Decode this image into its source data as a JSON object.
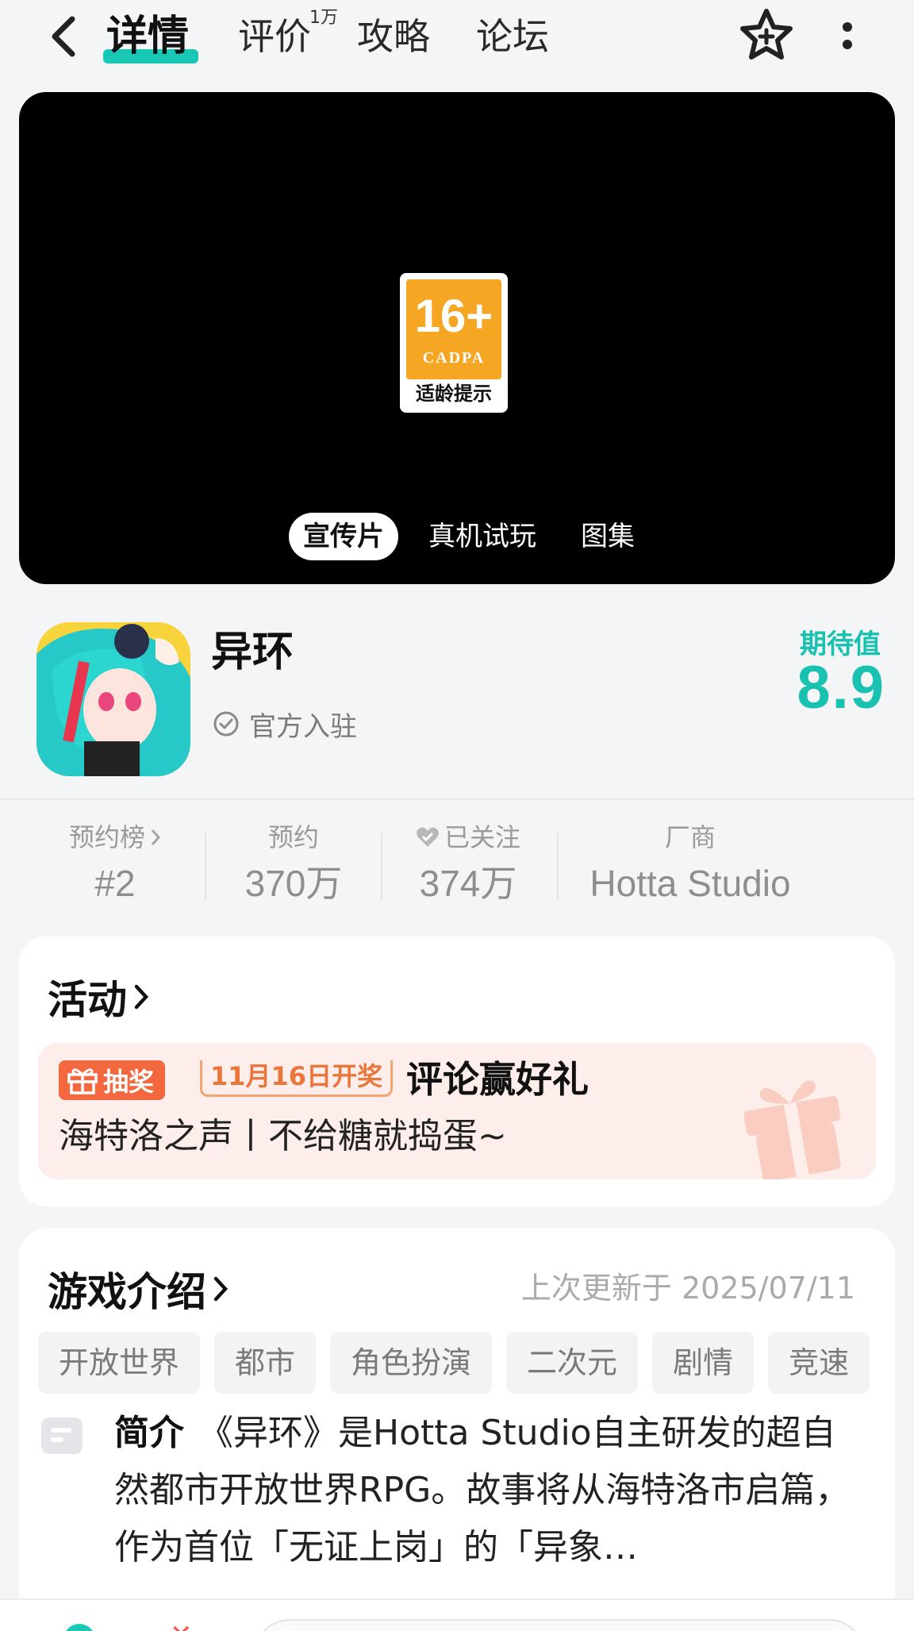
{
  "nav": {
    "tabs": [
      "详情",
      "评价",
      "攻略",
      "论坛"
    ],
    "review_badge": "1万"
  },
  "video": {
    "age_rating": "16+",
    "age_org": "CADPA",
    "age_caption": "适龄提示",
    "media_tabs": [
      "宣传片",
      "真机试玩",
      "图集"
    ],
    "active_media_tab": "宣传片"
  },
  "game": {
    "name": "异环",
    "official_label": "官方入驻",
    "expect_label": "期待值",
    "expect_score": "8.9"
  },
  "stats": [
    {
      "label": "预约榜",
      "value": "#2"
    },
    {
      "label": "预约",
      "value": "370万"
    },
    {
      "label": "已关注",
      "value": "374万"
    },
    {
      "label": "厂商",
      "value": "Hotta Studio"
    }
  ],
  "activity": {
    "title": "活动",
    "lottery_tag": "抽奖",
    "date_tag": "11月16日开奖",
    "banner_title": "评论赢好礼",
    "banner_subtitle": "海特洛之声丨不给糖就捣蛋~"
  },
  "intro": {
    "title": "游戏介绍",
    "updated": "上次更新于 2025/07/11",
    "tags": [
      "开放世界",
      "都市",
      "角色扮演",
      "二次元",
      "剧情",
      "竞速"
    ],
    "label": "简介",
    "text": "《异环》是Hotta Studio自主研发的超自然都市开放世界RPG。故事将从海特洛市启篇，作为首位「无证上岗」的「异象…"
  },
  "colors": {
    "accent": "#19c8b4",
    "lottery": "#f3683e",
    "banner_bg": "#fdeeec"
  }
}
